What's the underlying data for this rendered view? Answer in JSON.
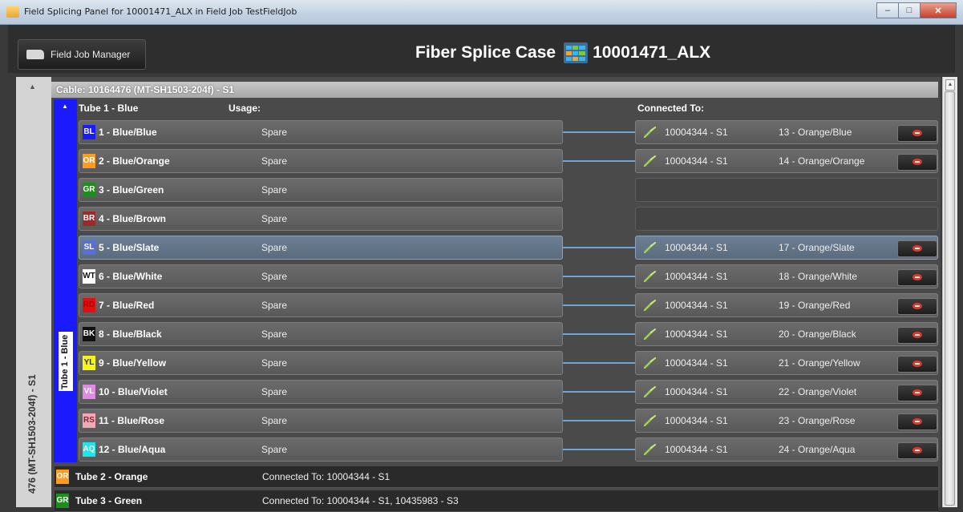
{
  "window": {
    "title": "Field Splicing Panel for 10001471_ALX in Field Job TestFieldJob",
    "minimize_label": "–",
    "maximize_label": "□",
    "close_label": "✕"
  },
  "header": {
    "field_job_manager_label": "Field Job Manager",
    "title_prefix": "Fiber Splice Case",
    "title_case_id": "10001471_ALX"
  },
  "cable": {
    "side_label": "476 (MT-SH1503-204f) - S1",
    "header_label": "Cable: 10164476 (MT-SH1503-204f) - S1",
    "tube_side_label": "Tube 1 - Blue",
    "tube_color": "#1a1aff"
  },
  "columns": {
    "tube": "Tube 1 - Blue",
    "usage": "Usage:",
    "connected_to": "Connected To:"
  },
  "fibers": [
    {
      "code": "BL",
      "chip_bg": "#1a1aff",
      "chip_fg": "#ffffff",
      "name": "1 - Blue/Blue",
      "usage": "Spare",
      "connected": true,
      "conn_id": "10004344 - S1",
      "conn_fiber": "13 - Orange/Blue",
      "selected": false
    },
    {
      "code": "OR",
      "chip_bg": "#ff9a1a",
      "chip_fg": "#ffffff",
      "name": "2 - Blue/Orange",
      "usage": "Spare",
      "connected": true,
      "conn_id": "10004344 - S1",
      "conn_fiber": "14 - Orange/Orange",
      "selected": false
    },
    {
      "code": "GR",
      "chip_bg": "#1a8f1a",
      "chip_fg": "#ffffff",
      "name": "3 - Blue/Green",
      "usage": "Spare",
      "connected": false,
      "conn_id": "",
      "conn_fiber": "",
      "selected": false
    },
    {
      "code": "BR",
      "chip_bg": "#9b2a2a",
      "chip_fg": "#ffffff",
      "name": "4 - Blue/Brown",
      "usage": "Spare",
      "connected": false,
      "conn_id": "",
      "conn_fiber": "",
      "selected": false
    },
    {
      "code": "SL",
      "chip_bg": "#5a6fd6",
      "chip_fg": "#ffffff",
      "name": "5 - Blue/Slate",
      "usage": "Spare",
      "connected": true,
      "conn_id": "10004344 - S1",
      "conn_fiber": "17 - Orange/Slate",
      "selected": true
    },
    {
      "code": "WT",
      "chip_bg": "#ffffff",
      "chip_fg": "#111111",
      "name": "6 - Blue/White",
      "usage": "Spare",
      "connected": true,
      "conn_id": "10004344 - S1",
      "conn_fiber": "18 - Orange/White",
      "selected": false
    },
    {
      "code": "RD",
      "chip_bg": "#e01010",
      "chip_fg": "#b00000",
      "name": "7 - Blue/Red",
      "usage": "Spare",
      "connected": true,
      "conn_id": "10004344 - S1",
      "conn_fiber": "19 - Orange/Red",
      "selected": false
    },
    {
      "code": "BK",
      "chip_bg": "#111111",
      "chip_fg": "#ffffff",
      "name": "8 - Blue/Black",
      "usage": "Spare",
      "connected": true,
      "conn_id": "10004344 - S1",
      "conn_fiber": "20 - Orange/Black",
      "selected": false
    },
    {
      "code": "YL",
      "chip_bg": "#f5f51a",
      "chip_fg": "#333333",
      "name": "9 - Blue/Yellow",
      "usage": "Spare",
      "connected": true,
      "conn_id": "10004344 - S1",
      "conn_fiber": "21 - Orange/Yellow",
      "selected": false
    },
    {
      "code": "VL",
      "chip_bg": "#e08ae6",
      "chip_fg": "#ffffff",
      "name": "10 - Blue/Violet",
      "usage": "Spare",
      "connected": true,
      "conn_id": "10004344 - S1",
      "conn_fiber": "22 - Orange/Violet",
      "selected": false
    },
    {
      "code": "RS",
      "chip_bg": "#f2a9b4",
      "chip_fg": "#7a2a3a",
      "name": "11 - Blue/Rose",
      "usage": "Spare",
      "connected": true,
      "conn_id": "10004344 - S1",
      "conn_fiber": "23 - Orange/Rose",
      "selected": false
    },
    {
      "code": "AQ",
      "chip_bg": "#1ae6f0",
      "chip_fg": "#ffffff",
      "name": "12 - Blue/Aqua",
      "usage": "Spare",
      "connected": true,
      "conn_id": "10004344 - S1",
      "conn_fiber": "24 - Orange/Aqua",
      "selected": false
    }
  ],
  "tubes": [
    {
      "code": "OR",
      "chip_bg": "#ff9a1a",
      "name": "Tube 2 - Orange",
      "connected": "Connected To: 10004344 - S1"
    },
    {
      "code": "GR",
      "chip_bg": "#1a8f1a",
      "name": "Tube 3 - Green",
      "connected": "Connected To: 10004344 - S1, 10435983 - S3"
    }
  ],
  "icons": {
    "splice": "splice-icon",
    "remove": "remove-connection-icon",
    "truck": "truck-icon"
  }
}
